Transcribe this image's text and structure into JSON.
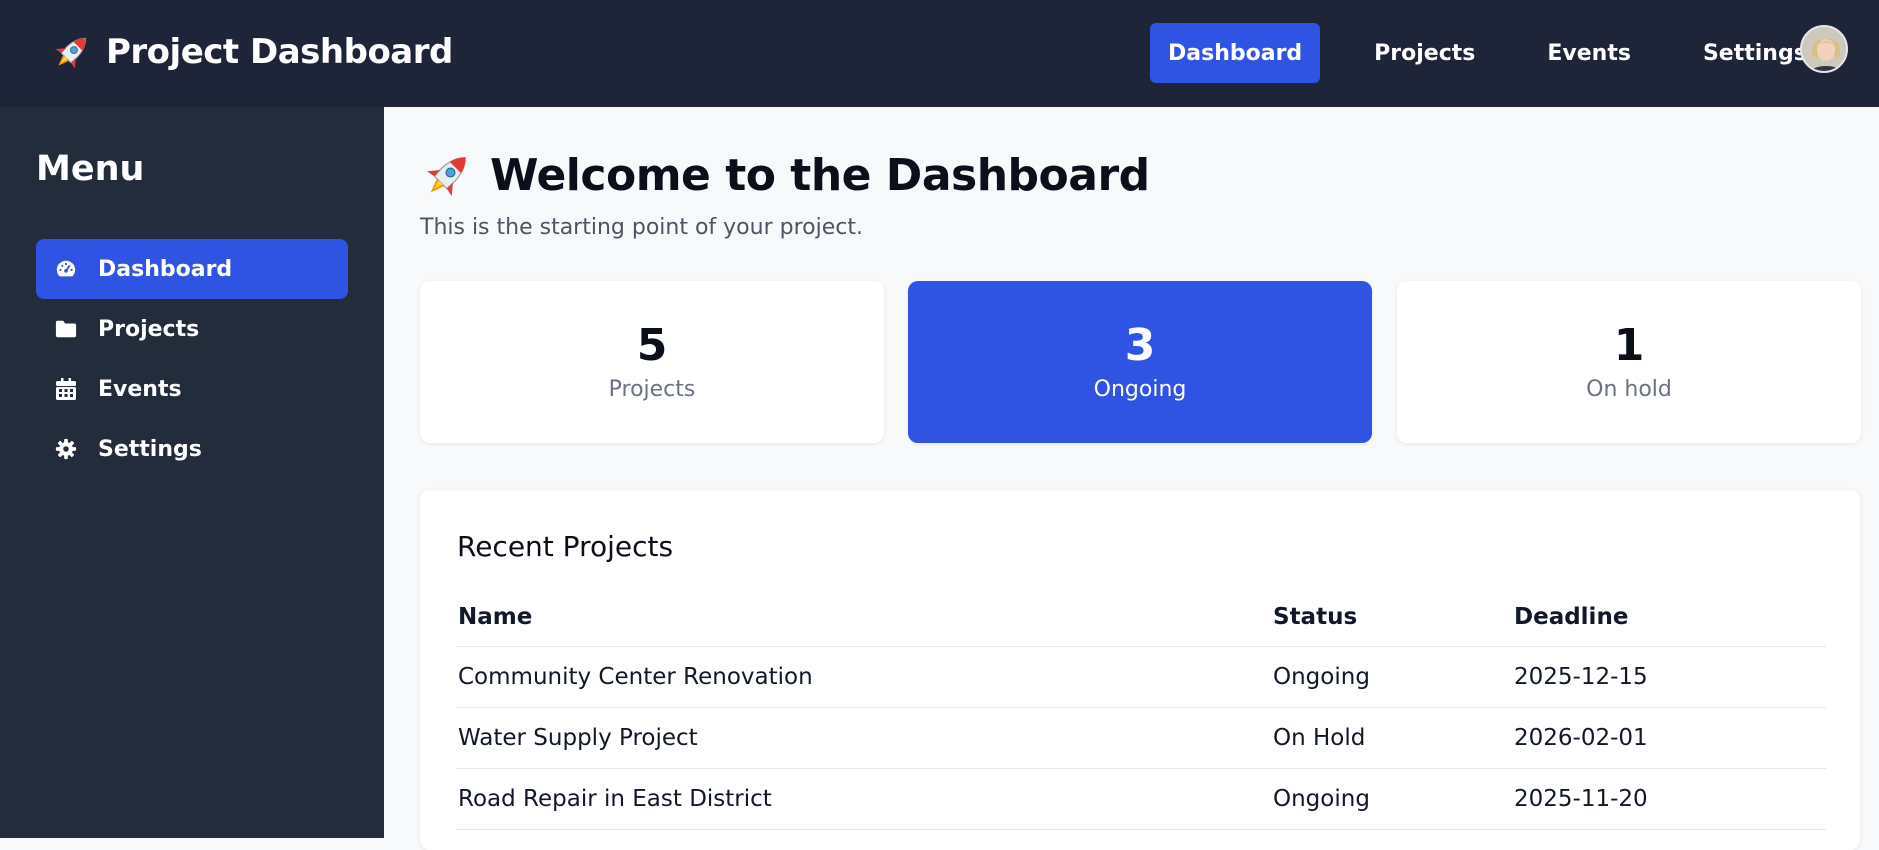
{
  "header": {
    "title": "Project Dashboard",
    "nav": [
      {
        "label": "Dashboard",
        "active": true
      },
      {
        "label": "Projects",
        "active": false
      },
      {
        "label": "Events",
        "active": false
      },
      {
        "label": "Settings",
        "active": false
      }
    ],
    "avatar_icon": "user-avatar"
  },
  "sidebar": {
    "title": "Menu",
    "items": [
      {
        "label": "Dashboard",
        "icon": "gauge-icon",
        "active": true
      },
      {
        "label": "Projects",
        "icon": "folder-icon",
        "active": false
      },
      {
        "label": "Events",
        "icon": "calendar-icon",
        "active": false
      },
      {
        "label": "Settings",
        "icon": "gear-icon",
        "active": false
      }
    ]
  },
  "main": {
    "title": "Welcome to the Dashboard",
    "subtitle": "This is the starting point of your project.",
    "stats": [
      {
        "value": "5",
        "label": "Projects"
      },
      {
        "value": "3",
        "label": "Ongoing"
      },
      {
        "value": "1",
        "label": "On hold"
      }
    ],
    "recent": {
      "title": "Recent Projects",
      "columns": [
        "Name",
        "Status",
        "Deadline"
      ],
      "rows": [
        [
          "Community Center Renovation",
          "Ongoing",
          "2025-12-15"
        ],
        [
          "Water Supply Project",
          "On Hold",
          "2026-02-01"
        ],
        [
          "Road Repair in East District",
          "Ongoing",
          "2025-11-20"
        ]
      ]
    }
  },
  "colors": {
    "navbar": "#1e2538",
    "sidebar": "#222c3b",
    "accent": "#2f54e4",
    "background": "#f8f9fb"
  }
}
